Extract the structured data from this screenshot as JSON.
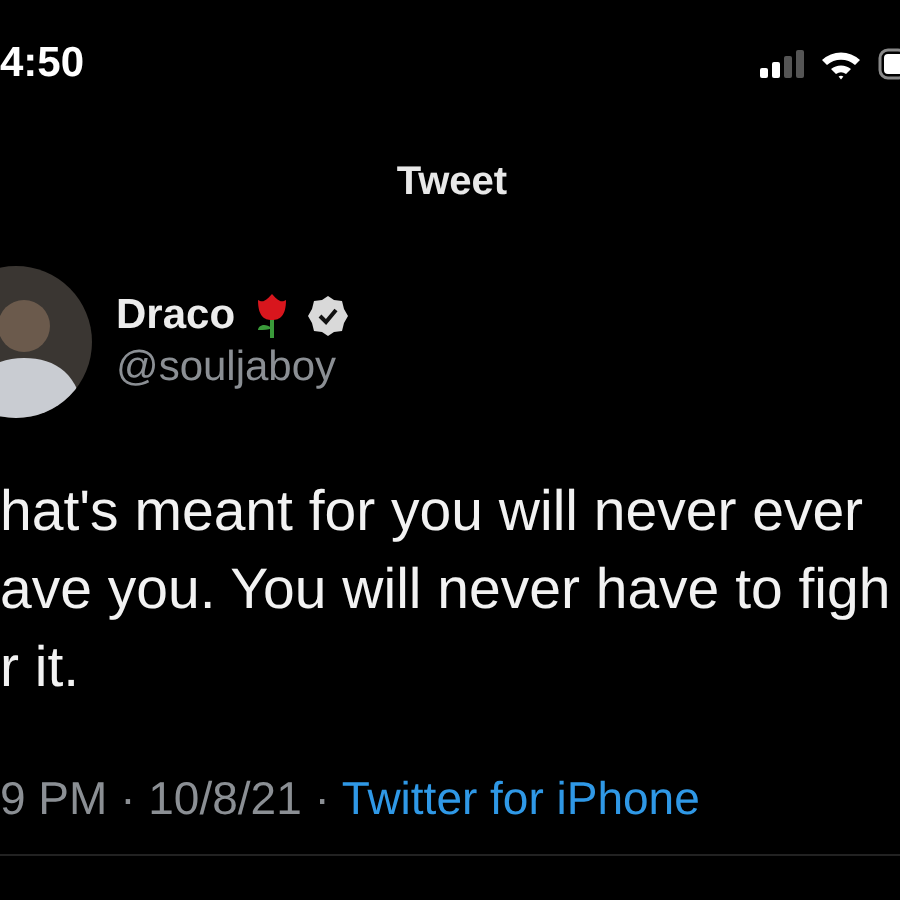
{
  "status_bar": {
    "time": "4:50"
  },
  "header": {
    "title": "Tweet"
  },
  "author": {
    "name": "Draco",
    "verified": true,
    "handle": "@souljaboy"
  },
  "tweet": {
    "lines": [
      "hat's meant for you will never ever",
      "ave you. You will never have to figh",
      "r it."
    ]
  },
  "meta": {
    "time_date": "9 PM · 10/8/21 ·",
    "source": "Twitter for iPhone"
  }
}
